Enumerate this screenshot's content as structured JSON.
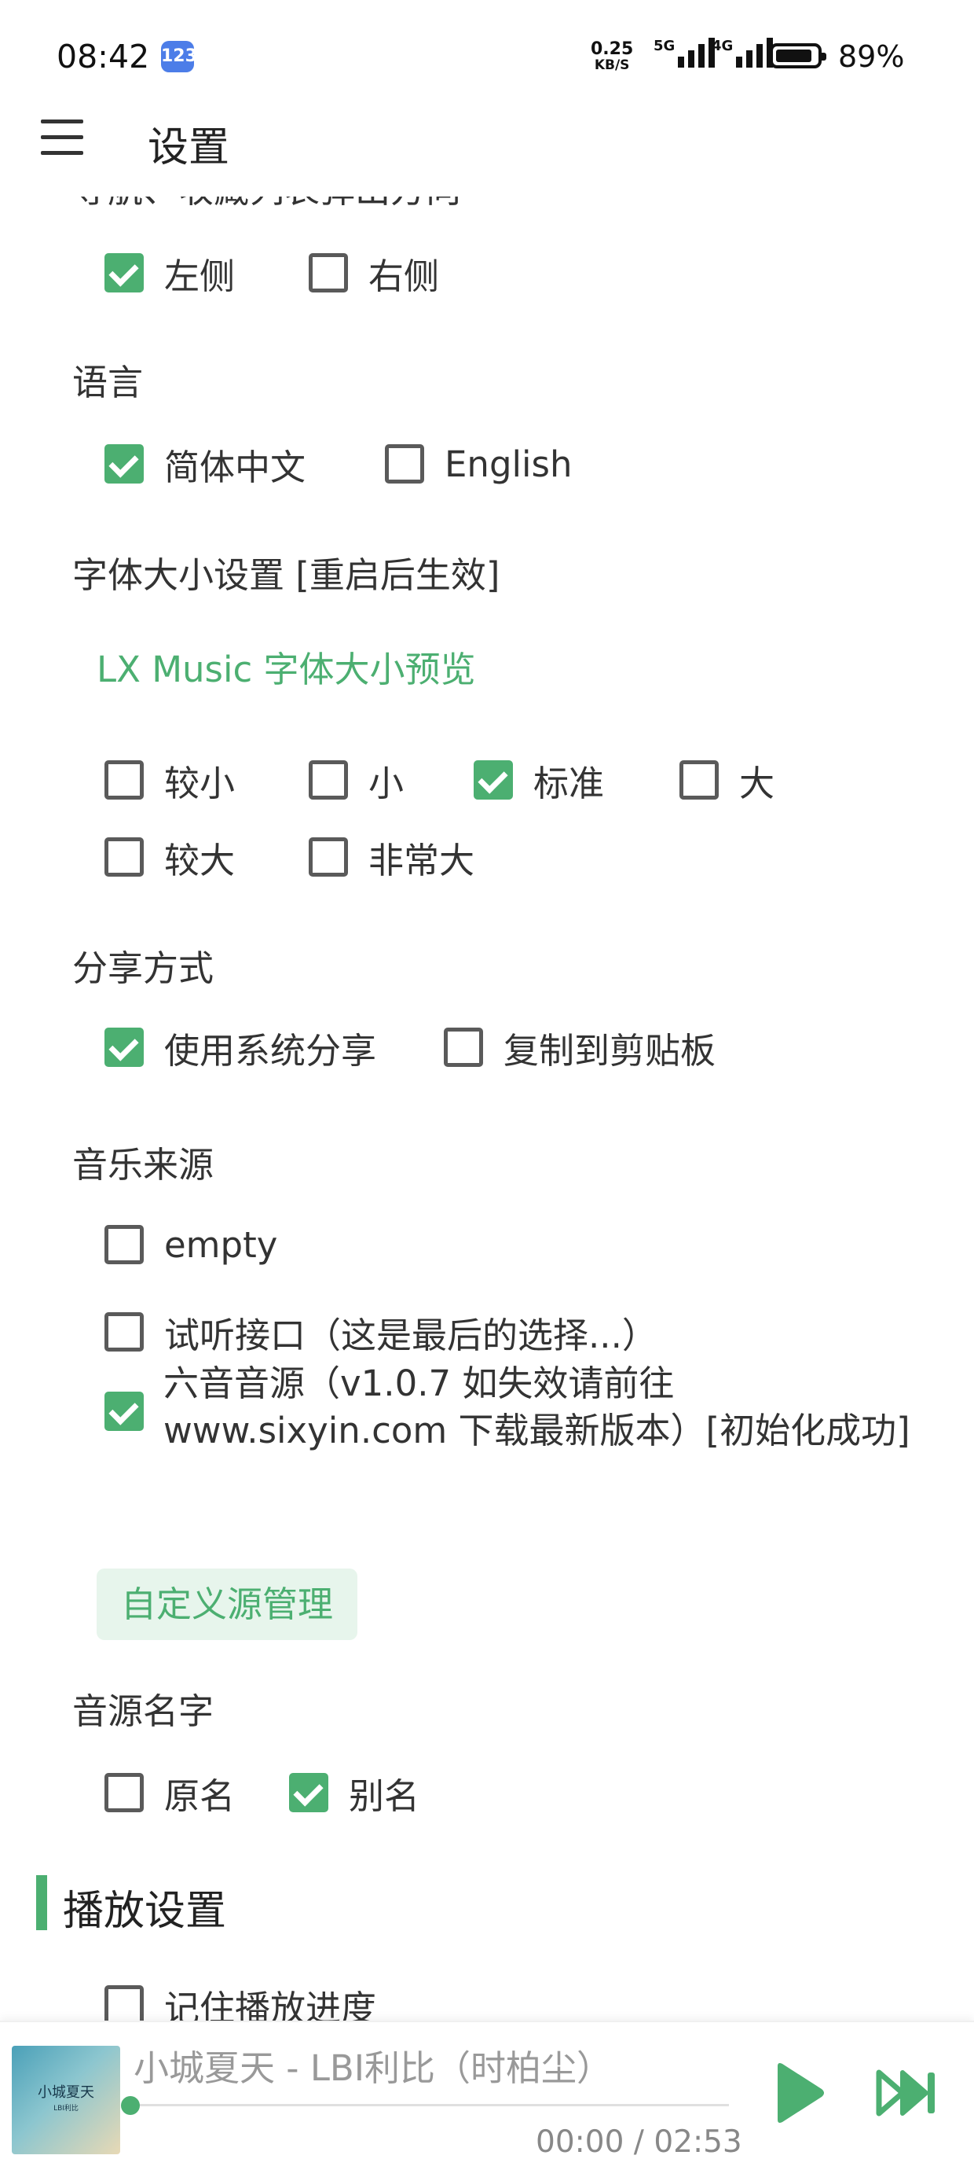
{
  "status_bar": {
    "time": "08:42",
    "badge": "123",
    "net_speed_value": "0.25",
    "net_speed_unit": "KB/S",
    "sim1_label": "5G",
    "sim2_label": "4G",
    "battery_percent": "89%",
    "battery_level": 0.89
  },
  "header": {
    "title": "设置"
  },
  "sections": {
    "nav_direction": {
      "label": "导航、收藏列表弹出方向",
      "options": [
        {
          "label": "左侧",
          "checked": true
        },
        {
          "label": "右侧",
          "checked": false
        }
      ]
    },
    "language": {
      "label": "语言",
      "options": [
        {
          "label": "简体中文",
          "checked": true
        },
        {
          "label": "English",
          "checked": false
        }
      ]
    },
    "font_size": {
      "label": "字体大小设置 [重启后生效]",
      "preview": "LX Music 字体大小预览",
      "options": [
        {
          "label": "较小",
          "checked": false
        },
        {
          "label": "小",
          "checked": false
        },
        {
          "label": "标准",
          "checked": true
        },
        {
          "label": "大",
          "checked": false
        },
        {
          "label": "较大",
          "checked": false
        },
        {
          "label": "非常大",
          "checked": false
        }
      ]
    },
    "share": {
      "label": "分享方式",
      "options": [
        {
          "label": "使用系统分享",
          "checked": true
        },
        {
          "label": "复制到剪贴板",
          "checked": false
        }
      ]
    },
    "music_source": {
      "label": "音乐来源",
      "options": [
        {
          "label": "empty",
          "checked": false
        },
        {
          "label": "试听接口（这是最后的选择...）",
          "checked": false
        },
        {
          "label": "六音音源（v1.0.7 如失效请前往 www.sixyin.com 下载最新版本）[初始化成功]",
          "checked": true
        }
      ],
      "manage_button": "自定义源管理"
    },
    "source_name": {
      "label": "音源名字",
      "options": [
        {
          "label": "原名",
          "checked": false
        },
        {
          "label": "别名",
          "checked": true
        }
      ]
    },
    "playback": {
      "group_title": "播放设置",
      "options": [
        {
          "label": "记住播放进度",
          "checked": false
        }
      ]
    }
  },
  "player": {
    "song": "小城夏天 - LBI利比（时柏尘）",
    "cover_title": "小城夏天",
    "cover_subtitle": "LBI利比",
    "time": "00:00 / 02:53",
    "progress": 0,
    "accent_color": "#4caf71"
  }
}
